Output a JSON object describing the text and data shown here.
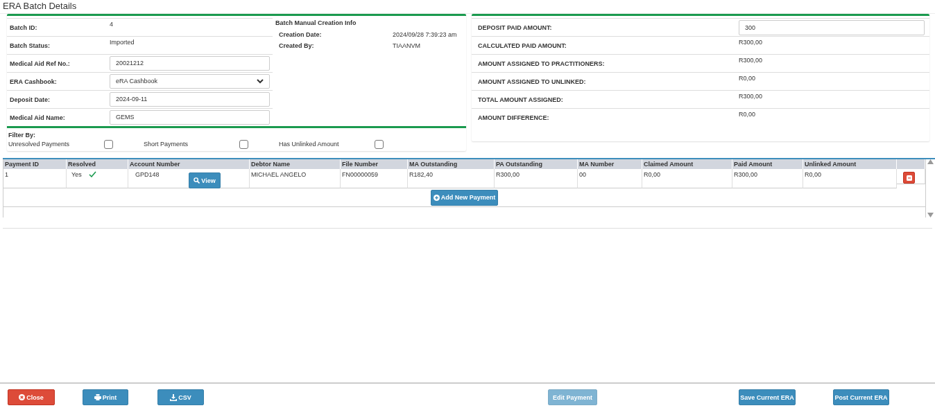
{
  "title": "ERA Batch Details",
  "batch_fields": [
    {
      "label": "Batch ID:",
      "kind": "text",
      "value": "4"
    },
    {
      "label": "Batch Status:",
      "kind": "text",
      "value": "Imported"
    },
    {
      "label": "Medical Aid Ref No.:",
      "kind": "input",
      "value": "20021212"
    },
    {
      "label": "ERA Cashbook:",
      "kind": "select",
      "value": "eRA Cashbook"
    },
    {
      "label": "Deposit Date:",
      "kind": "input",
      "value": "2024-09-11"
    },
    {
      "label": "Medical Aid Name:",
      "kind": "input",
      "value": "GEMS"
    }
  ],
  "creation_info": {
    "heading": "Batch Manual Creation Info",
    "rows": [
      {
        "label": "Creation Date:",
        "value": "2024/09/28 7:39:23 am"
      },
      {
        "label": "Created By:",
        "value": "TIAANVM"
      }
    ]
  },
  "filter": {
    "heading": "Filter By:",
    "options": [
      {
        "label": "Unresolved Payments",
        "checked": false
      },
      {
        "label": "Short Payments",
        "checked": false
      },
      {
        "label": "Has Unlinked Amount",
        "checked": false
      }
    ]
  },
  "amounts": [
    {
      "label": "DEPOSIT PAID AMOUNT:",
      "kind": "input",
      "value": "300"
    },
    {
      "label": "CALCULATED PAID AMOUNT:",
      "kind": "text",
      "value": "R300,00"
    },
    {
      "label": "AMOUNT ASSIGNED TO PRACTITIONERS:",
      "kind": "text",
      "value": "R300,00"
    },
    {
      "label": "AMOUNT ASSIGNED TO UNLINKED:",
      "kind": "text",
      "value": "R0,00"
    },
    {
      "label": "TOTAL AMOUNT ASSIGNED:",
      "kind": "text",
      "value": "R300,00"
    },
    {
      "label": "AMOUNT DIFFERENCE:",
      "kind": "text",
      "value": "R0,00"
    }
  ],
  "table": {
    "columns": [
      "Payment ID",
      "Resolved",
      "Account Number",
      "Debtor Name",
      "File Number",
      "MA Outstanding",
      "PA Outstanding",
      "MA Number",
      "Claimed Amount",
      "Paid Amount",
      "Unlinked Amount"
    ],
    "rows": [
      {
        "payment_id": "1",
        "resolved_text": "Yes",
        "resolved": true,
        "account_number": "GPD148",
        "view_button": "View",
        "debtor_name": "MICHAEL ANGELO",
        "file_number": "FN00000059",
        "ma_outstanding": "R182,40",
        "pa_outstanding": "R300,00",
        "ma_number": "00",
        "claimed_amount": "R0,00",
        "paid_amount": "R300,00",
        "unlinked_amount": "R0,00"
      }
    ],
    "add_button": "Add New Payment"
  },
  "footer_buttons": [
    {
      "label": "Close",
      "kind": "danger",
      "disabled": false
    },
    {
      "label": "Print",
      "kind": "primary",
      "disabled": false
    },
    {
      "label": "CSV",
      "kind": "primary",
      "disabled": false
    },
    {
      "label": "Edit Payment",
      "kind": "primary",
      "disabled": true
    },
    {
      "label": "Save Current ERA",
      "kind": "primary",
      "disabled": false
    },
    {
      "label": "Post Current ERA",
      "kind": "primary",
      "disabled": false
    }
  ]
}
